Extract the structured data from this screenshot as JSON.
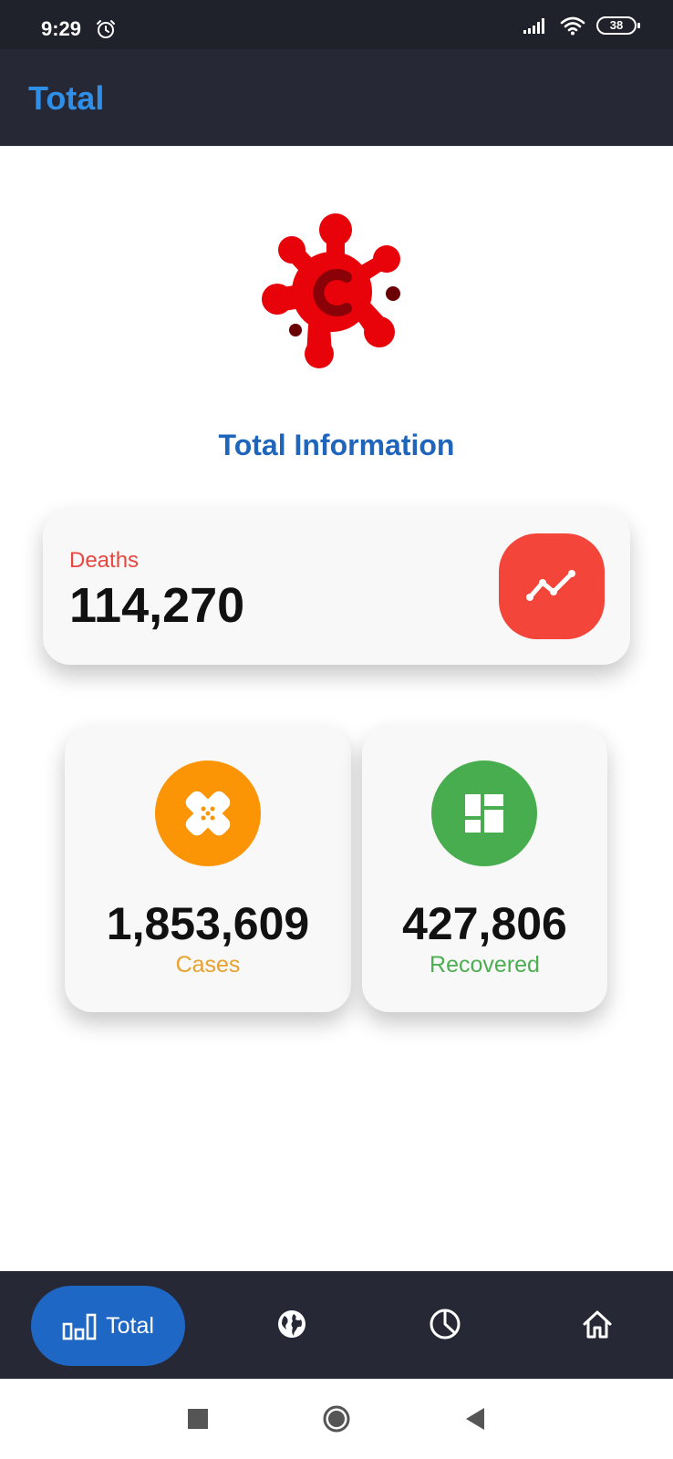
{
  "status_bar": {
    "time": "9:29",
    "battery": "38"
  },
  "app_bar": {
    "title": "Total"
  },
  "main": {
    "section_title": "Total Information",
    "deaths": {
      "label": "Deaths",
      "value": "114,270"
    },
    "cases": {
      "label": "Cases",
      "value": "1,853,609"
    },
    "recovered": {
      "label": "Recovered",
      "value": "427,806"
    }
  },
  "bottom_nav": {
    "items": [
      {
        "label": "Total",
        "icon": "bar-chart-icon",
        "active": true
      },
      {
        "label": "",
        "icon": "globe-icon",
        "active": false
      },
      {
        "label": "",
        "icon": "pie-chart-icon",
        "active": false
      },
      {
        "label": "",
        "icon": "home-icon",
        "active": false
      }
    ]
  },
  "colors": {
    "app_bar": "#262835",
    "title_blue": "#2f8fe8",
    "section_blue": "#1f65bc",
    "deaths_red": "#f3453a",
    "cases_orange": "#fb9506",
    "recovered_green": "#48ad4e",
    "nav_active": "#1f67c4"
  }
}
